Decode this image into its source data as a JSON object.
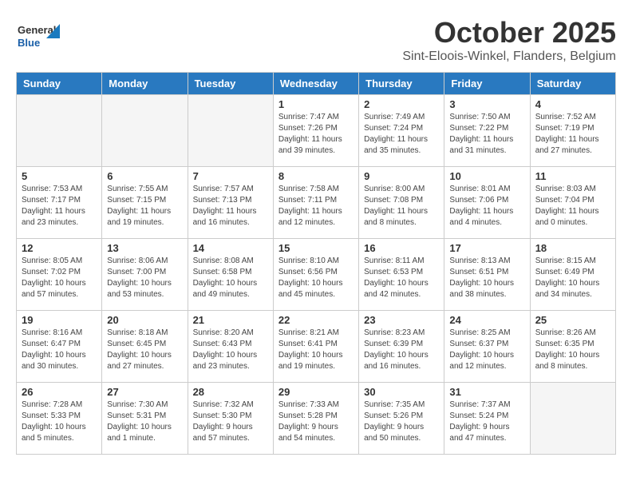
{
  "header": {
    "logo_general": "General",
    "logo_blue": "Blue",
    "month_year": "October 2025",
    "location": "Sint-Eloois-Winkel, Flanders, Belgium"
  },
  "days_of_week": [
    "Sunday",
    "Monday",
    "Tuesday",
    "Wednesday",
    "Thursday",
    "Friday",
    "Saturday"
  ],
  "weeks": [
    [
      {
        "day": "",
        "info": ""
      },
      {
        "day": "",
        "info": ""
      },
      {
        "day": "",
        "info": ""
      },
      {
        "day": "1",
        "info": "Sunrise: 7:47 AM\nSunset: 7:26 PM\nDaylight: 11 hours\nand 39 minutes."
      },
      {
        "day": "2",
        "info": "Sunrise: 7:49 AM\nSunset: 7:24 PM\nDaylight: 11 hours\nand 35 minutes."
      },
      {
        "day": "3",
        "info": "Sunrise: 7:50 AM\nSunset: 7:22 PM\nDaylight: 11 hours\nand 31 minutes."
      },
      {
        "day": "4",
        "info": "Sunrise: 7:52 AM\nSunset: 7:19 PM\nDaylight: 11 hours\nand 27 minutes."
      }
    ],
    [
      {
        "day": "5",
        "info": "Sunrise: 7:53 AM\nSunset: 7:17 PM\nDaylight: 11 hours\nand 23 minutes."
      },
      {
        "day": "6",
        "info": "Sunrise: 7:55 AM\nSunset: 7:15 PM\nDaylight: 11 hours\nand 19 minutes."
      },
      {
        "day": "7",
        "info": "Sunrise: 7:57 AM\nSunset: 7:13 PM\nDaylight: 11 hours\nand 16 minutes."
      },
      {
        "day": "8",
        "info": "Sunrise: 7:58 AM\nSunset: 7:11 PM\nDaylight: 11 hours\nand 12 minutes."
      },
      {
        "day": "9",
        "info": "Sunrise: 8:00 AM\nSunset: 7:08 PM\nDaylight: 11 hours\nand 8 minutes."
      },
      {
        "day": "10",
        "info": "Sunrise: 8:01 AM\nSunset: 7:06 PM\nDaylight: 11 hours\nand 4 minutes."
      },
      {
        "day": "11",
        "info": "Sunrise: 8:03 AM\nSunset: 7:04 PM\nDaylight: 11 hours\nand 0 minutes."
      }
    ],
    [
      {
        "day": "12",
        "info": "Sunrise: 8:05 AM\nSunset: 7:02 PM\nDaylight: 10 hours\nand 57 minutes."
      },
      {
        "day": "13",
        "info": "Sunrise: 8:06 AM\nSunset: 7:00 PM\nDaylight: 10 hours\nand 53 minutes."
      },
      {
        "day": "14",
        "info": "Sunrise: 8:08 AM\nSunset: 6:58 PM\nDaylight: 10 hours\nand 49 minutes."
      },
      {
        "day": "15",
        "info": "Sunrise: 8:10 AM\nSunset: 6:56 PM\nDaylight: 10 hours\nand 45 minutes."
      },
      {
        "day": "16",
        "info": "Sunrise: 8:11 AM\nSunset: 6:53 PM\nDaylight: 10 hours\nand 42 minutes."
      },
      {
        "day": "17",
        "info": "Sunrise: 8:13 AM\nSunset: 6:51 PM\nDaylight: 10 hours\nand 38 minutes."
      },
      {
        "day": "18",
        "info": "Sunrise: 8:15 AM\nSunset: 6:49 PM\nDaylight: 10 hours\nand 34 minutes."
      }
    ],
    [
      {
        "day": "19",
        "info": "Sunrise: 8:16 AM\nSunset: 6:47 PM\nDaylight: 10 hours\nand 30 minutes."
      },
      {
        "day": "20",
        "info": "Sunrise: 8:18 AM\nSunset: 6:45 PM\nDaylight: 10 hours\nand 27 minutes."
      },
      {
        "day": "21",
        "info": "Sunrise: 8:20 AM\nSunset: 6:43 PM\nDaylight: 10 hours\nand 23 minutes."
      },
      {
        "day": "22",
        "info": "Sunrise: 8:21 AM\nSunset: 6:41 PM\nDaylight: 10 hours\nand 19 minutes."
      },
      {
        "day": "23",
        "info": "Sunrise: 8:23 AM\nSunset: 6:39 PM\nDaylight: 10 hours\nand 16 minutes."
      },
      {
        "day": "24",
        "info": "Sunrise: 8:25 AM\nSunset: 6:37 PM\nDaylight: 10 hours\nand 12 minutes."
      },
      {
        "day": "25",
        "info": "Sunrise: 8:26 AM\nSunset: 6:35 PM\nDaylight: 10 hours\nand 8 minutes."
      }
    ],
    [
      {
        "day": "26",
        "info": "Sunrise: 7:28 AM\nSunset: 5:33 PM\nDaylight: 10 hours\nand 5 minutes."
      },
      {
        "day": "27",
        "info": "Sunrise: 7:30 AM\nSunset: 5:31 PM\nDaylight: 10 hours\nand 1 minute."
      },
      {
        "day": "28",
        "info": "Sunrise: 7:32 AM\nSunset: 5:30 PM\nDaylight: 9 hours\nand 57 minutes."
      },
      {
        "day": "29",
        "info": "Sunrise: 7:33 AM\nSunset: 5:28 PM\nDaylight: 9 hours\nand 54 minutes."
      },
      {
        "day": "30",
        "info": "Sunrise: 7:35 AM\nSunset: 5:26 PM\nDaylight: 9 hours\nand 50 minutes."
      },
      {
        "day": "31",
        "info": "Sunrise: 7:37 AM\nSunset: 5:24 PM\nDaylight: 9 hours\nand 47 minutes."
      },
      {
        "day": "",
        "info": ""
      }
    ]
  ]
}
